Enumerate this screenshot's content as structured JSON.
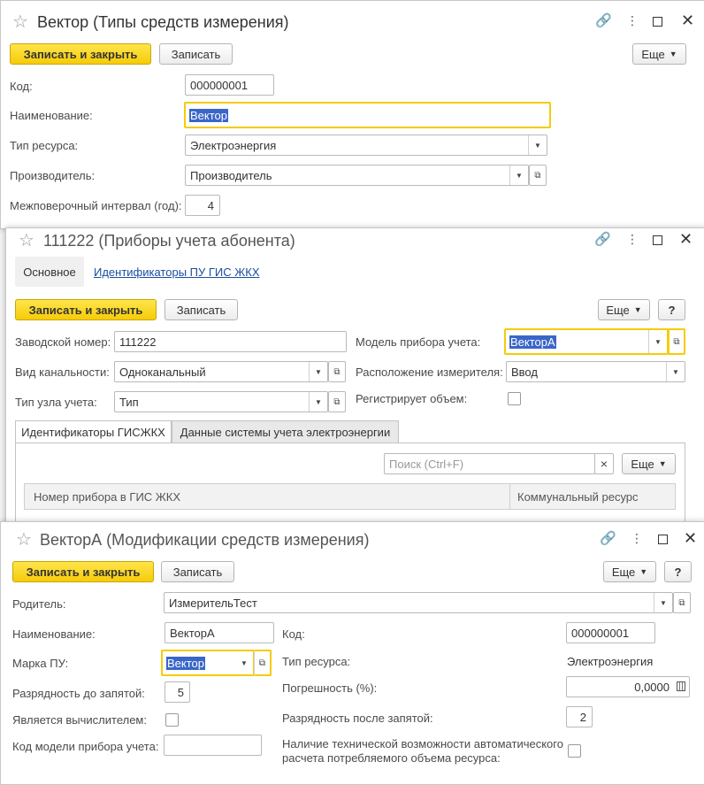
{
  "icons": {
    "star": "star-icon",
    "link": "link-icon",
    "more": "more-menu-icon",
    "maximize": "maximize-icon",
    "close": "close-icon",
    "dropdown": "chevron-down-icon",
    "open": "open-form-icon",
    "clear": "clear-icon",
    "calendar": "calculator-icon"
  },
  "win1": {
    "title": "Вектор (Типы средств измерения)",
    "save_close": "Записать и закрыть",
    "save": "Записать",
    "more": "Еще",
    "code_label": "Код:",
    "code_value": "000000001",
    "name_label": "Наименование:",
    "name_value": "Вектор",
    "resource_label": "Тип ресурса:",
    "resource_value": "Электроэнергия",
    "maker_label": "Производитель:",
    "maker_value": "Производитель",
    "interval_label": "Межповерочный интервал (год):",
    "interval_value": "4"
  },
  "win2": {
    "title": "111222 (Приборы учета абонента)",
    "tab_main": "Основное",
    "tab_ids": "Идентификаторы ПУ ГИС ЖКХ",
    "save_close": "Записать и закрыть",
    "save": "Записать",
    "more": "Еще",
    "help": "?",
    "serial_label": "Заводской номер:",
    "serial_value": "111222",
    "channel_label": "Вид канальности:",
    "channel_value": "Одноканальный",
    "node_label": "Тип узла учета:",
    "node_value": "Тип",
    "model_label": "Модель прибора учета:",
    "model_value": "ВекторА",
    "location_label": "Расположение измерителя:",
    "location_value": "Ввод",
    "volume_label": "Регистрирует объем:",
    "subtab_gis": "Идентификаторы ГИСЖКХ",
    "subtab_elec": "Данные системы учета электроэнергии",
    "search_placeholder": "Поиск (Ctrl+F)",
    "clear": "×",
    "grid_more": "Еще",
    "col_number": "Номер прибора в ГИС ЖКХ",
    "col_resource": "Коммунальный ресурс"
  },
  "win3": {
    "title": "ВекторА (Модификации средств измерения)",
    "save_close": "Записать и закрыть",
    "save": "Записать",
    "more": "Еще",
    "help": "?",
    "parent_label": "Родитель:",
    "parent_value": "ИзмерительТест",
    "name_label": "Наименование:",
    "name_value": "ВекторА",
    "brand_label": "Марка ПУ:",
    "brand_value": "Вектор",
    "digits_before_label": "Разрядность до запятой:",
    "digits_before_value": "5",
    "is_calc_label": "Является вычислителем:",
    "model_code_label": "Код модели прибора учета:",
    "code_label": "Код:",
    "code_value": "000000001",
    "resource_label": "Тип ресурса:",
    "resource_value": "Электроэнергия",
    "error_label": "Погрешность (%):",
    "error_value": "0,0000",
    "digits_after_label": "Разрядность после запятой:",
    "digits_after_value": "2",
    "auto_label_1": "Наличие технической возможности автоматического",
    "auto_label_2": "расчета потребляемого объема ресурса:"
  }
}
